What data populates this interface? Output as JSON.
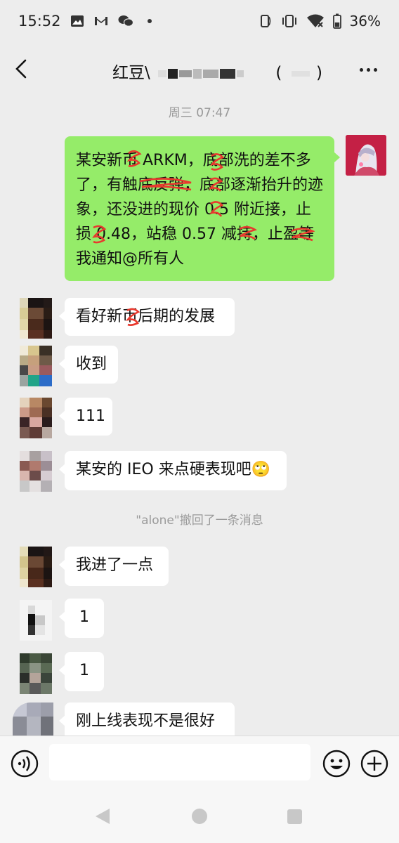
{
  "status": {
    "time": "15:52",
    "battery": "36%"
  },
  "header": {
    "title": "红豆\\",
    "title_suffix": "(",
    "title_end": ")"
  },
  "chat": {
    "timestamp": "周三 07:47",
    "my_message": "某安新币 ARKM，底部洗的差不多了，有触底反弹，底部逐渐抬升的迹象，还没进的现价 0.5 附近接，止损 0.48，站稳 0.57 减持，止盈等我通知@所有人",
    "messages": [
      {
        "text": "看好新币后期的发展"
      },
      {
        "text": "收到"
      },
      {
        "text": "111"
      },
      {
        "text": "某安的 IEO 来点硬表现吧🙄"
      },
      {
        "text": "我进了一点"
      },
      {
        "text": "1"
      },
      {
        "text": "1"
      },
      {
        "text": "刚上线表现不是很好"
      }
    ],
    "recall_notice": "\"alone\"撤回了一条消息"
  },
  "input": {
    "value": "",
    "placeholder": ""
  },
  "colors": {
    "background": "#ededed",
    "my_bubble": "#95ec69",
    "other_bubble": "#ffffff",
    "system_text": "#999999"
  },
  "icons": {
    "back": "chevron-left-icon",
    "more": "more-dots-icon",
    "voice": "voice-icon",
    "emoji": "emoji-icon",
    "plus": "plus-icon"
  }
}
